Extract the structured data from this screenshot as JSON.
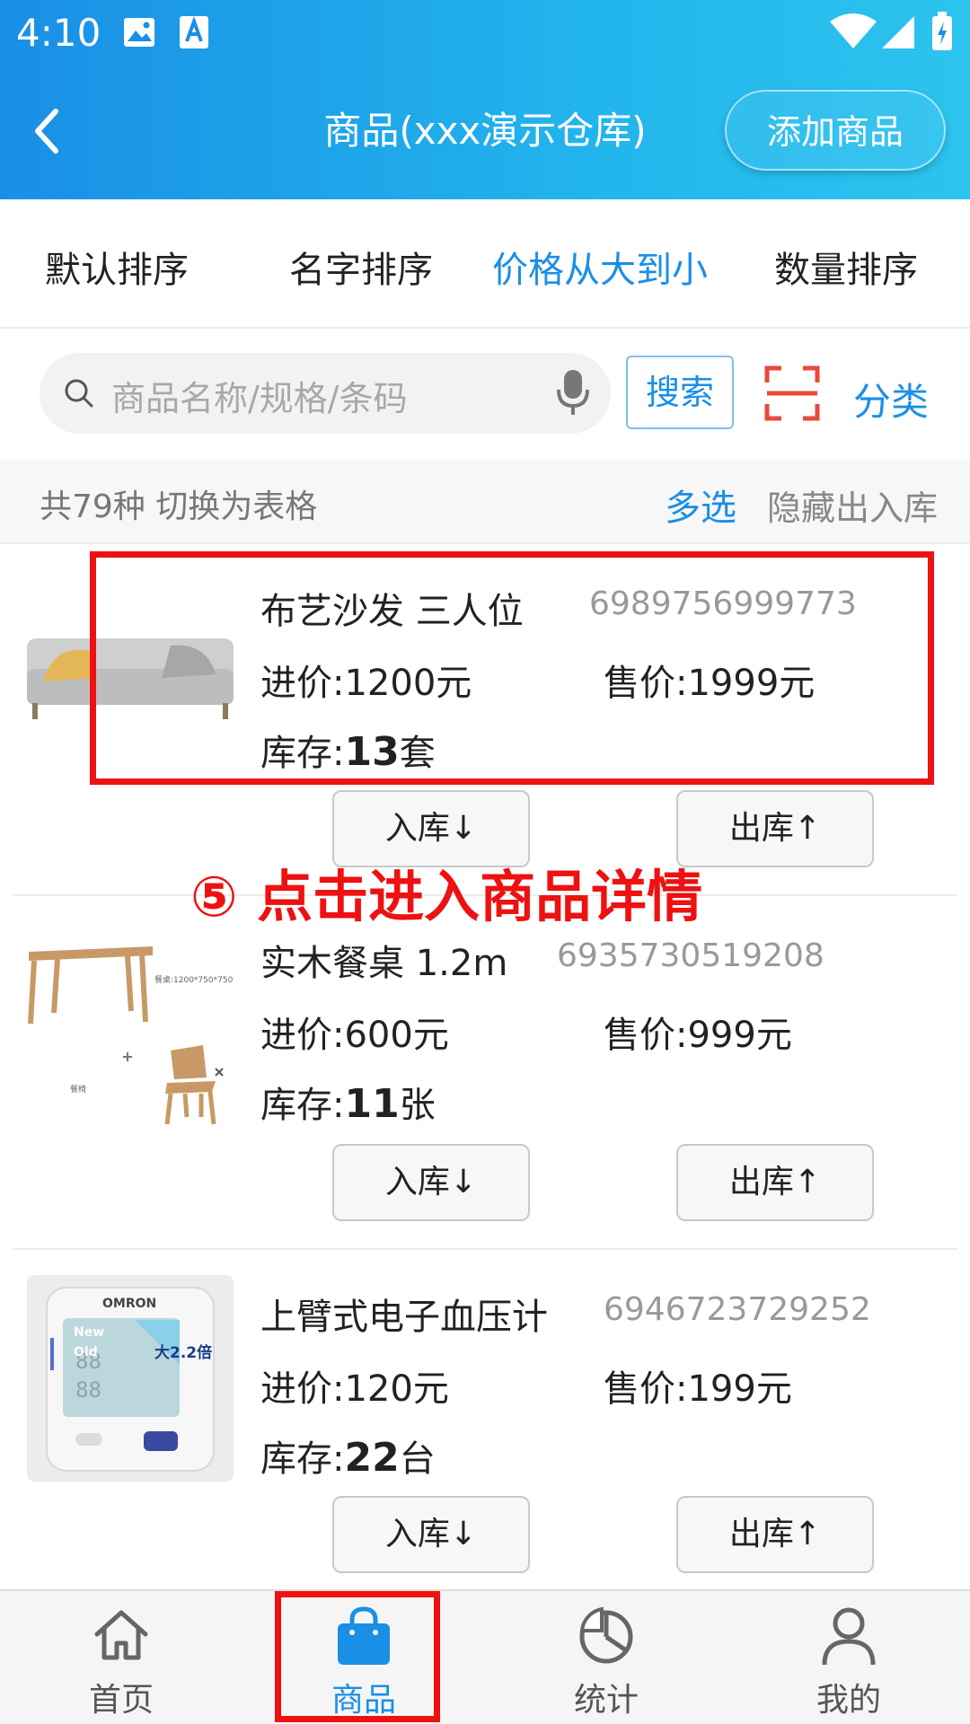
{
  "status_bar": {
    "time": "4:10"
  },
  "header": {
    "title": "商品(xxx演示仓库)",
    "add_button": "添加商品"
  },
  "sort_tabs": [
    "默认排序",
    "名字排序",
    "价格从大到小",
    "数量排序"
  ],
  "active_sort_index": 2,
  "search": {
    "placeholder": "商品名称/规格/条码",
    "button": "搜索",
    "category": "分类"
  },
  "list_header": {
    "count_text": "共79种  切换为表格",
    "multi_select": "多选",
    "hide_io": "隐藏出入库"
  },
  "products": [
    {
      "name": "布艺沙发  三人位",
      "code": "6989756999773",
      "purchase_label": "进价:",
      "purchase": "1200元",
      "sale_label": "售价:",
      "sale": "1999元",
      "stock_label": "库存:",
      "stock_qty": "13",
      "stock_unit": "套",
      "in_button": "入库↓",
      "out_button": "出库↑"
    },
    {
      "name": "实木餐桌  1.2m",
      "code": "6935730519208",
      "purchase_label": "进价:",
      "purchase": "600元",
      "sale_label": "售价:",
      "sale": "999元",
      "stock_label": "库存:",
      "stock_qty": "11",
      "stock_unit": "张",
      "in_button": "入库↓",
      "out_button": "出库↑"
    },
    {
      "name": "上臂式电子血压计",
      "code": "6946723729252",
      "purchase_label": "进价:",
      "purchase": "120元",
      "sale_label": "售价:",
      "sale": "199元",
      "stock_label": "库存:",
      "stock_qty": "22",
      "stock_unit": "台",
      "in_button": "入库↓",
      "out_button": "出库↑"
    }
  ],
  "product_image_text": {
    "table_spec": "餐桌:1200*750*750mm",
    "chair_label": "餐椅",
    "bp_brand": "OMRON",
    "bp_new": "New",
    "bp_old": "Old",
    "bp_badge": "大2.2倍"
  },
  "annotation": {
    "step_text": "⑤ 点击进入商品详情"
  },
  "bottom_nav": [
    {
      "label": "首页",
      "icon": "home-icon"
    },
    {
      "label": "商品",
      "icon": "shopping-bag-icon"
    },
    {
      "label": "统计",
      "icon": "pie-chart-icon"
    },
    {
      "label": "我的",
      "icon": "user-icon"
    }
  ],
  "active_nav_index": 1,
  "colors": {
    "primary": "#1a8fe6",
    "annotation_red": "#ee1111",
    "scan_red": "#e94a3a"
  }
}
